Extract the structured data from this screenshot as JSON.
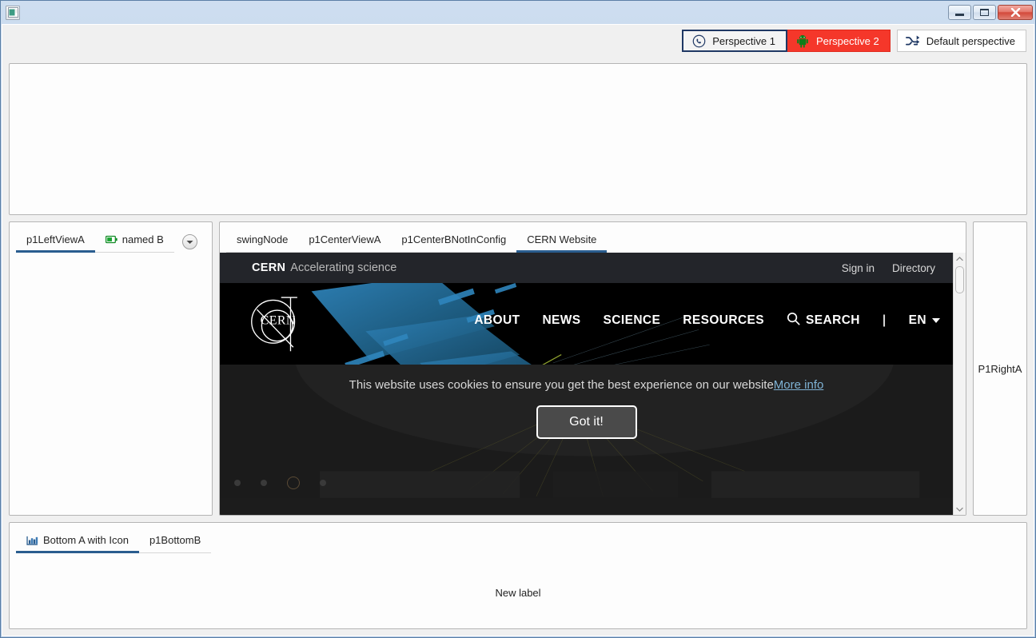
{
  "window": {
    "title": "",
    "icon": "app-window-icon",
    "buttons": {
      "minimize": "—",
      "maximize": "□",
      "close": "✕"
    }
  },
  "toolbar": {
    "perspectives": [
      {
        "label": "Perspective 1",
        "icon": "whatsapp-circle-icon",
        "state": "selected",
        "color": "#1f3864"
      },
      {
        "label": "Perspective 2",
        "icon": "android-robot-icon",
        "state": "accent",
        "color": "#f5372a"
      },
      {
        "label": "Default perspective",
        "icon": "shuffle-icon",
        "state": "plain",
        "color": "#1f3864"
      }
    ]
  },
  "panels": {
    "top": {
      "name": "empty-top-pane",
      "content": ""
    },
    "left": {
      "tabs": [
        {
          "label": "p1LeftViewA",
          "icon": null,
          "active": true
        },
        {
          "label": "named B",
          "icon": "battery-icon",
          "active": false
        }
      ],
      "overflow_icon": "chevron-down-circle-icon",
      "content": ""
    },
    "center": {
      "tabs": [
        {
          "label": "swingNode",
          "active": false
        },
        {
          "label": "p1CenterViewA",
          "active": false
        },
        {
          "label": "p1CenterBNotInConfig",
          "active": false
        },
        {
          "label": "CERN Website",
          "active": true
        }
      ]
    },
    "right": {
      "label": "P1RightA"
    },
    "bottom": {
      "tabs": [
        {
          "label": "Bottom A with Icon",
          "icon": "bar-chart-icon",
          "active": true
        },
        {
          "label": "p1BottomB",
          "icon": null,
          "active": false
        }
      ],
      "content_label": "New label"
    }
  },
  "browser": {
    "site": {
      "topbar": {
        "brand": "CERN",
        "brand_sub": "Accelerating science",
        "links": [
          "Sign in",
          "Directory"
        ]
      },
      "logo_text": "CERN",
      "nav": [
        "ABOUT",
        "NEWS",
        "SCIENCE",
        "RESOURCES"
      ],
      "search_label": "SEARCH",
      "nav_separator": "|",
      "language": "EN",
      "cookie": {
        "message": "This website uses cookies to ensure you get the best experience on our website",
        "link": "More info",
        "accept_button": "Got it!"
      }
    },
    "scrollbar": {
      "up": "▲",
      "down": "▼",
      "position": "top"
    }
  }
}
